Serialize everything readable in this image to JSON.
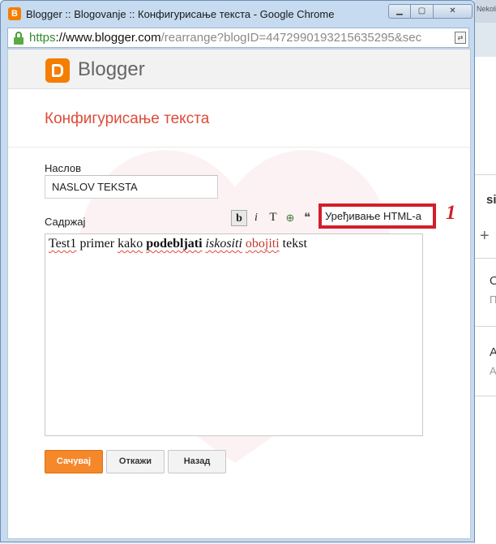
{
  "window": {
    "title": "Blogger :: Blogovanje :: Конфигурисање текста - Google Chrome",
    "min_glyph": "▁",
    "max_glyph": "▢",
    "close_glyph": "✕"
  },
  "address": {
    "scheme": "https",
    "host": "://www.blogger.com",
    "rest": "/rearrange?blogID=4472990193215635295&sec"
  },
  "brand": {
    "name": "Blogger",
    "color": "#f57d00"
  },
  "dialog": {
    "title": "Конфигурисање текста",
    "title_label": "Наслов",
    "title_value": "NASLOV TEKSTA",
    "content_label": "Садржај",
    "edit_html_label": "Уређивање HTML-а",
    "annotation": "1"
  },
  "toolbar": {
    "bold": "b",
    "italic": "i",
    "font": "T",
    "link": "⊕",
    "quote": "❝",
    "icons": [
      "bold-icon",
      "italic-icon",
      "font-color-icon",
      "link-icon",
      "quote-icon"
    ]
  },
  "editor": {
    "w1": "Test1",
    "w2": " primer ",
    "w3": "kako",
    "w4": " ",
    "w5": "podebljati",
    "w6": " ",
    "w7": "iskositi",
    "w8": " ",
    "w9": "obojiti",
    "w10": " tekst"
  },
  "buttons": {
    "save": "Сачувај",
    "cancel": "Откажи",
    "back": "Назад"
  },
  "background_page": {
    "tab": "Nekoliko stvari is na",
    "heading": "si",
    "plus": "+",
    "item1": "O",
    "item1_sub": "П",
    "item2": "A",
    "item2_sub": "A"
  },
  "colors": {
    "accent_title": "#dd4b39",
    "save_button": "#f5882a",
    "annotation_red": "#d21f2b"
  }
}
